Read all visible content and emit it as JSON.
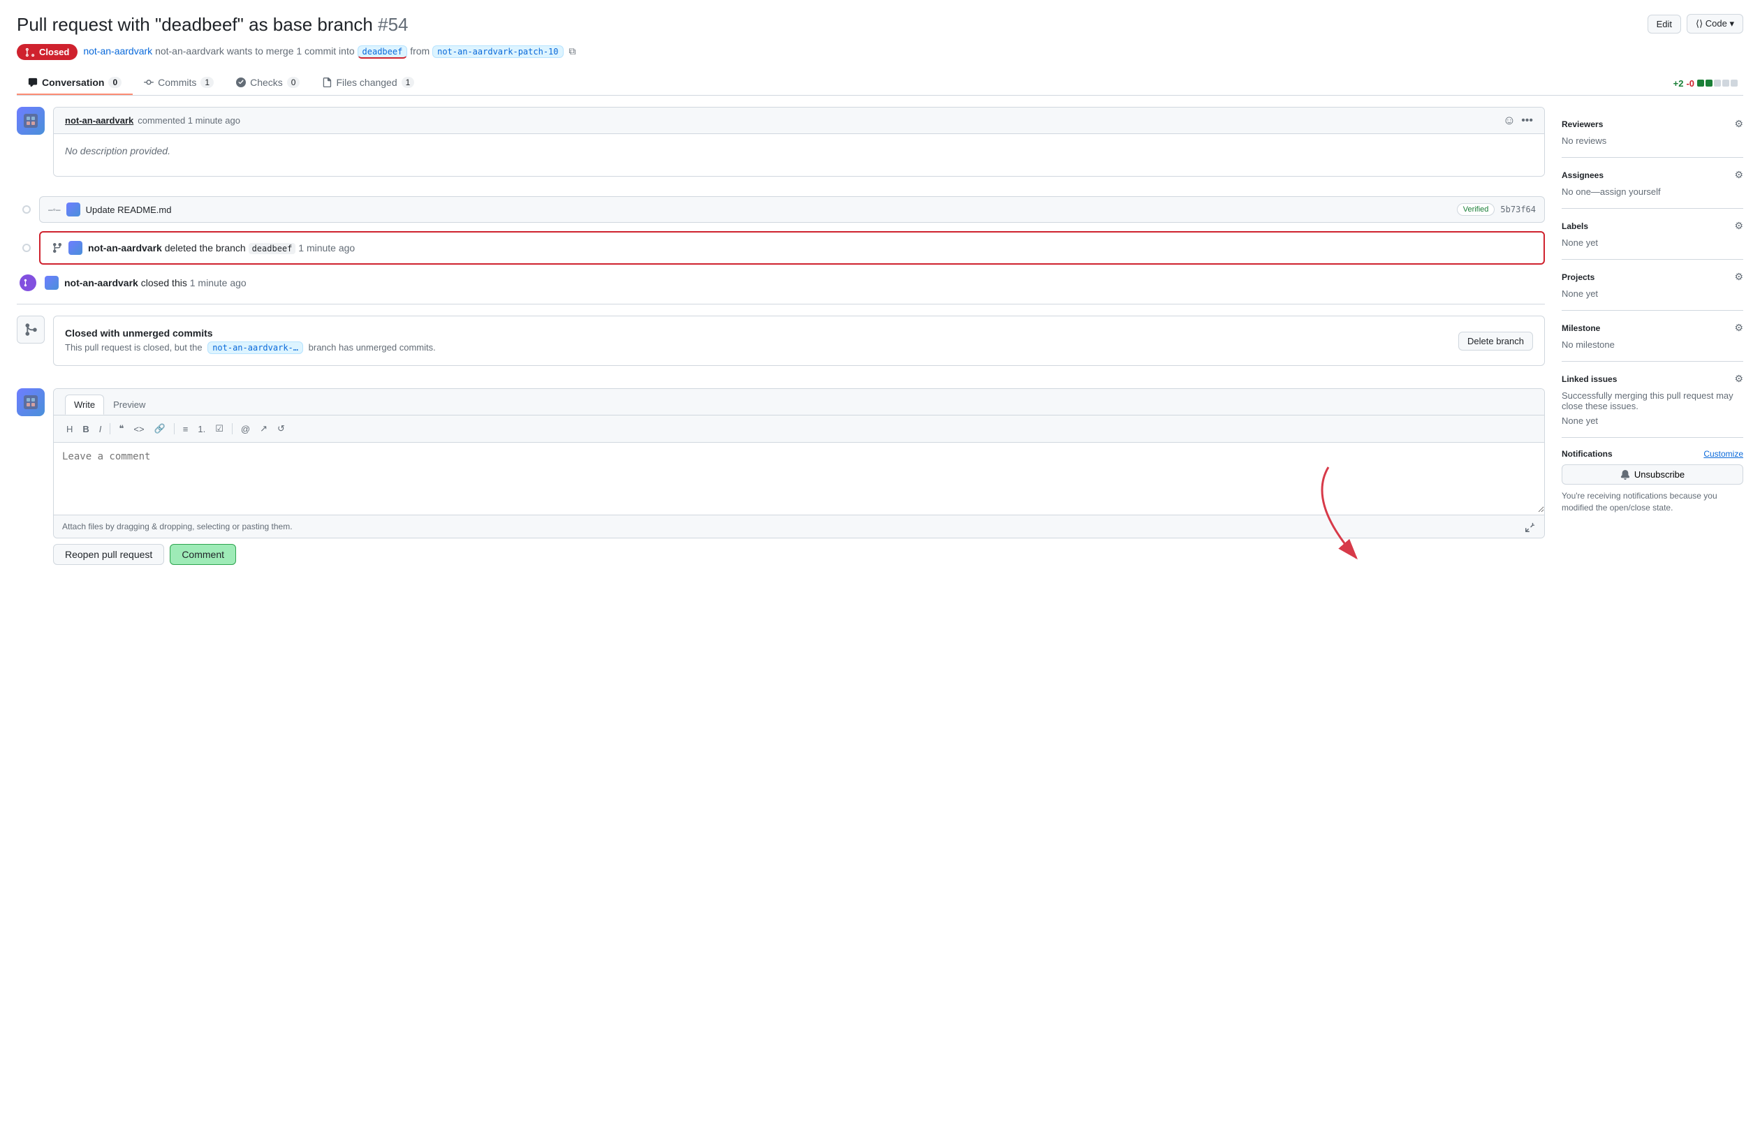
{
  "page": {
    "title": "Pull request with \"deadbeef\" as base branch",
    "pr_number": "#54",
    "edit_label": "Edit",
    "code_label": "⟨⟩ Code ▾"
  },
  "status": {
    "badge": "Closed",
    "description": "not-an-aardvark wants to merge 1 commit into",
    "base_branch": "deadbeef",
    "from_text": "from",
    "head_branch": "not-an-aardvark-patch-10"
  },
  "tabs": [
    {
      "id": "conversation",
      "label": "Conversation",
      "count": "0",
      "active": true
    },
    {
      "id": "commits",
      "label": "Commits",
      "count": "1",
      "active": false
    },
    {
      "id": "checks",
      "label": "Checks",
      "count": "0",
      "active": false
    },
    {
      "id": "files_changed",
      "label": "Files changed",
      "count": "1",
      "active": false
    }
  ],
  "diff_stat": {
    "add": "+2",
    "del": "-0",
    "blocks": [
      "green",
      "green",
      "gray",
      "gray",
      "gray"
    ]
  },
  "comment": {
    "author": "not-an-aardvark",
    "time": "commented 1 minute ago",
    "body": "No description provided."
  },
  "commit": {
    "message": "Update README.md",
    "verified": "Verified",
    "hash": "5b73f64"
  },
  "delete_branch_event": {
    "actor": "not-an-aardvark",
    "action": "deleted the branch",
    "branch": "deadbeef",
    "time": "1 minute ago"
  },
  "closed_event": {
    "actor": "not-an-aardvark",
    "action": "closed this",
    "time": "1 minute ago"
  },
  "unmerged": {
    "title": "Closed with unmerged commits",
    "description": "This pull request is closed, but the",
    "branch": "not-an-aardvark-…",
    "description2": "branch has unmerged commits.",
    "delete_branch_label": "Delete branch"
  },
  "write_area": {
    "write_tab": "Write",
    "preview_tab": "Preview",
    "placeholder": "Leave a comment",
    "attach_text": "Attach files by dragging & dropping, selecting or pasting them.",
    "reopen_label": "Reopen pull request",
    "comment_label": "Comment"
  },
  "sidebar": {
    "reviewers": {
      "title": "Reviewers",
      "value": "No reviews"
    },
    "assignees": {
      "title": "Assignees",
      "value": "No one—assign yourself"
    },
    "labels": {
      "title": "Labels",
      "value": "None yet"
    },
    "projects": {
      "title": "Projects",
      "value": "None yet"
    },
    "milestone": {
      "title": "Milestone",
      "value": "No milestone"
    },
    "linked_issues": {
      "title": "Linked issues",
      "description": "Successfully merging this pull request may close these issues.",
      "value": "None yet"
    },
    "notifications": {
      "title": "Notifications",
      "customize": "Customize",
      "unsubscribe": "Unsubscribe",
      "description": "You're receiving notifications because you modified the open/close state."
    }
  }
}
